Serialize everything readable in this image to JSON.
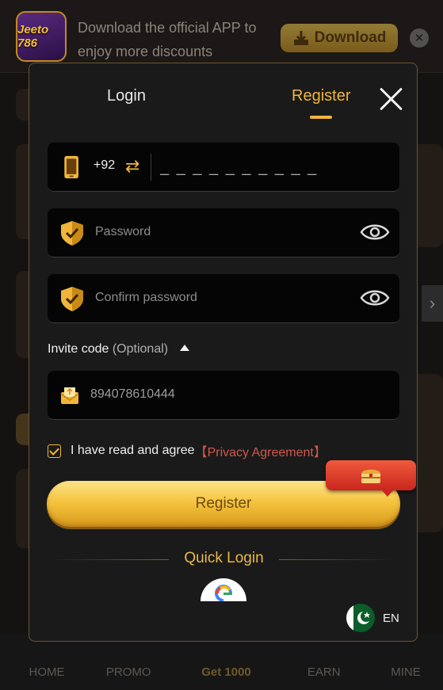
{
  "banner": {
    "logo_text": "Jeeto 786",
    "promo_text": "Download the official APP to enjoy more discounts",
    "download_label": "Download"
  },
  "modal": {
    "tabs": [
      {
        "label": "Login",
        "active": false
      },
      {
        "label": "Register",
        "active": true
      }
    ],
    "phone": {
      "country_code": "+92",
      "placeholder": "_ _ _ _ _ _ _ _ _ _"
    },
    "password": {
      "placeholder": "Password"
    },
    "confirm_password": {
      "placeholder": "Confirm password"
    },
    "invite": {
      "label": "Invite code",
      "optional": "(Optional)",
      "value": "894078610444"
    },
    "agree": {
      "text": "I have read and agree",
      "link": "【Privacy Agreement】",
      "checked": true
    },
    "register_label": "Register",
    "quick_login_label": "Quick Login",
    "language": "EN"
  },
  "bottom_nav": [
    "HOME",
    "PROMO",
    "Get 1000",
    "EARN",
    "MINE"
  ],
  "colors": {
    "accent": "#f0b63a",
    "link": "#d0584d",
    "modal_bg": "#1a1a1a"
  }
}
